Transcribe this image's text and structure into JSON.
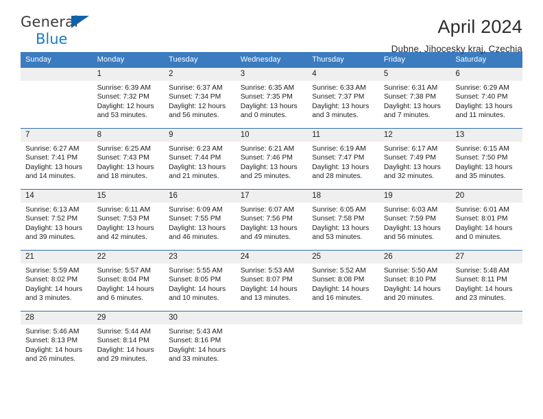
{
  "brand": {
    "name_top": "General",
    "name_bottom": "Blue",
    "triangle_color": "#1162a8",
    "blue": "#1b7ac4"
  },
  "header": {
    "title": "April 2024",
    "subtitle": "Dubne, Jihocesky kraj, Czechia"
  },
  "calendar": {
    "header_bg": "#3b7cc0",
    "header_text_color": "#ffffff",
    "row_divider_color": "#2f6eb5",
    "daynum_bg": "#efefef",
    "weekdays": [
      "Sunday",
      "Monday",
      "Tuesday",
      "Wednesday",
      "Thursday",
      "Friday",
      "Saturday"
    ],
    "weeks": [
      [
        {
          "day": "",
          "sunrise": "",
          "sunset": "",
          "daylight_line1": "",
          "daylight_line2": ""
        },
        {
          "day": "1",
          "sunrise": "Sunrise: 6:39 AM",
          "sunset": "Sunset: 7:32 PM",
          "daylight_line1": "Daylight: 12 hours",
          "daylight_line2": "and 53 minutes."
        },
        {
          "day": "2",
          "sunrise": "Sunrise: 6:37 AM",
          "sunset": "Sunset: 7:34 PM",
          "daylight_line1": "Daylight: 12 hours",
          "daylight_line2": "and 56 minutes."
        },
        {
          "day": "3",
          "sunrise": "Sunrise: 6:35 AM",
          "sunset": "Sunset: 7:35 PM",
          "daylight_line1": "Daylight: 13 hours",
          "daylight_line2": "and 0 minutes."
        },
        {
          "day": "4",
          "sunrise": "Sunrise: 6:33 AM",
          "sunset": "Sunset: 7:37 PM",
          "daylight_line1": "Daylight: 13 hours",
          "daylight_line2": "and 3 minutes."
        },
        {
          "day": "5",
          "sunrise": "Sunrise: 6:31 AM",
          "sunset": "Sunset: 7:38 PM",
          "daylight_line1": "Daylight: 13 hours",
          "daylight_line2": "and 7 minutes."
        },
        {
          "day": "6",
          "sunrise": "Sunrise: 6:29 AM",
          "sunset": "Sunset: 7:40 PM",
          "daylight_line1": "Daylight: 13 hours",
          "daylight_line2": "and 11 minutes."
        }
      ],
      [
        {
          "day": "7",
          "sunrise": "Sunrise: 6:27 AM",
          "sunset": "Sunset: 7:41 PM",
          "daylight_line1": "Daylight: 13 hours",
          "daylight_line2": "and 14 minutes."
        },
        {
          "day": "8",
          "sunrise": "Sunrise: 6:25 AM",
          "sunset": "Sunset: 7:43 PM",
          "daylight_line1": "Daylight: 13 hours",
          "daylight_line2": "and 18 minutes."
        },
        {
          "day": "9",
          "sunrise": "Sunrise: 6:23 AM",
          "sunset": "Sunset: 7:44 PM",
          "daylight_line1": "Daylight: 13 hours",
          "daylight_line2": "and 21 minutes."
        },
        {
          "day": "10",
          "sunrise": "Sunrise: 6:21 AM",
          "sunset": "Sunset: 7:46 PM",
          "daylight_line1": "Daylight: 13 hours",
          "daylight_line2": "and 25 minutes."
        },
        {
          "day": "11",
          "sunrise": "Sunrise: 6:19 AM",
          "sunset": "Sunset: 7:47 PM",
          "daylight_line1": "Daylight: 13 hours",
          "daylight_line2": "and 28 minutes."
        },
        {
          "day": "12",
          "sunrise": "Sunrise: 6:17 AM",
          "sunset": "Sunset: 7:49 PM",
          "daylight_line1": "Daylight: 13 hours",
          "daylight_line2": "and 32 minutes."
        },
        {
          "day": "13",
          "sunrise": "Sunrise: 6:15 AM",
          "sunset": "Sunset: 7:50 PM",
          "daylight_line1": "Daylight: 13 hours",
          "daylight_line2": "and 35 minutes."
        }
      ],
      [
        {
          "day": "14",
          "sunrise": "Sunrise: 6:13 AM",
          "sunset": "Sunset: 7:52 PM",
          "daylight_line1": "Daylight: 13 hours",
          "daylight_line2": "and 39 minutes."
        },
        {
          "day": "15",
          "sunrise": "Sunrise: 6:11 AM",
          "sunset": "Sunset: 7:53 PM",
          "daylight_line1": "Daylight: 13 hours",
          "daylight_line2": "and 42 minutes."
        },
        {
          "day": "16",
          "sunrise": "Sunrise: 6:09 AM",
          "sunset": "Sunset: 7:55 PM",
          "daylight_line1": "Daylight: 13 hours",
          "daylight_line2": "and 46 minutes."
        },
        {
          "day": "17",
          "sunrise": "Sunrise: 6:07 AM",
          "sunset": "Sunset: 7:56 PM",
          "daylight_line1": "Daylight: 13 hours",
          "daylight_line2": "and 49 minutes."
        },
        {
          "day": "18",
          "sunrise": "Sunrise: 6:05 AM",
          "sunset": "Sunset: 7:58 PM",
          "daylight_line1": "Daylight: 13 hours",
          "daylight_line2": "and 53 minutes."
        },
        {
          "day": "19",
          "sunrise": "Sunrise: 6:03 AM",
          "sunset": "Sunset: 7:59 PM",
          "daylight_line1": "Daylight: 13 hours",
          "daylight_line2": "and 56 minutes."
        },
        {
          "day": "20",
          "sunrise": "Sunrise: 6:01 AM",
          "sunset": "Sunset: 8:01 PM",
          "daylight_line1": "Daylight: 14 hours",
          "daylight_line2": "and 0 minutes."
        }
      ],
      [
        {
          "day": "21",
          "sunrise": "Sunrise: 5:59 AM",
          "sunset": "Sunset: 8:02 PM",
          "daylight_line1": "Daylight: 14 hours",
          "daylight_line2": "and 3 minutes."
        },
        {
          "day": "22",
          "sunrise": "Sunrise: 5:57 AM",
          "sunset": "Sunset: 8:04 PM",
          "daylight_line1": "Daylight: 14 hours",
          "daylight_line2": "and 6 minutes."
        },
        {
          "day": "23",
          "sunrise": "Sunrise: 5:55 AM",
          "sunset": "Sunset: 8:05 PM",
          "daylight_line1": "Daylight: 14 hours",
          "daylight_line2": "and 10 minutes."
        },
        {
          "day": "24",
          "sunrise": "Sunrise: 5:53 AM",
          "sunset": "Sunset: 8:07 PM",
          "daylight_line1": "Daylight: 14 hours",
          "daylight_line2": "and 13 minutes."
        },
        {
          "day": "25",
          "sunrise": "Sunrise: 5:52 AM",
          "sunset": "Sunset: 8:08 PM",
          "daylight_line1": "Daylight: 14 hours",
          "daylight_line2": "and 16 minutes."
        },
        {
          "day": "26",
          "sunrise": "Sunrise: 5:50 AM",
          "sunset": "Sunset: 8:10 PM",
          "daylight_line1": "Daylight: 14 hours",
          "daylight_line2": "and 20 minutes."
        },
        {
          "day": "27",
          "sunrise": "Sunrise: 5:48 AM",
          "sunset": "Sunset: 8:11 PM",
          "daylight_line1": "Daylight: 14 hours",
          "daylight_line2": "and 23 minutes."
        }
      ],
      [
        {
          "day": "28",
          "sunrise": "Sunrise: 5:46 AM",
          "sunset": "Sunset: 8:13 PM",
          "daylight_line1": "Daylight: 14 hours",
          "daylight_line2": "and 26 minutes."
        },
        {
          "day": "29",
          "sunrise": "Sunrise: 5:44 AM",
          "sunset": "Sunset: 8:14 PM",
          "daylight_line1": "Daylight: 14 hours",
          "daylight_line2": "and 29 minutes."
        },
        {
          "day": "30",
          "sunrise": "Sunrise: 5:43 AM",
          "sunset": "Sunset: 8:16 PM",
          "daylight_line1": "Daylight: 14 hours",
          "daylight_line2": "and 33 minutes."
        },
        {
          "day": "",
          "sunrise": "",
          "sunset": "",
          "daylight_line1": "",
          "daylight_line2": ""
        },
        {
          "day": "",
          "sunrise": "",
          "sunset": "",
          "daylight_line1": "",
          "daylight_line2": ""
        },
        {
          "day": "",
          "sunrise": "",
          "sunset": "",
          "daylight_line1": "",
          "daylight_line2": ""
        },
        {
          "day": "",
          "sunrise": "",
          "sunset": "",
          "daylight_line1": "",
          "daylight_line2": ""
        }
      ]
    ]
  }
}
